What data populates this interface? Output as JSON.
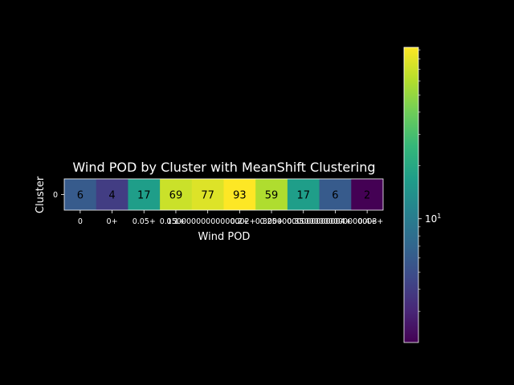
{
  "chart_data": {
    "type": "heatmap",
    "title": "Wind POD by Cluster with MeanShift Clustering",
    "xlabel": "Wind POD",
    "ylabel": "Cluster",
    "x_categories": [
      "0",
      "0+",
      "0.05+",
      "0.1+",
      "0.15+",
      "0.2+",
      "0.25+",
      "0.3+",
      "0.35+",
      "0.4+"
    ],
    "x_tick_labels_printed": [
      "0",
      "0+",
      "0.05+",
      "0.1+",
      "0.15000000000000002+",
      "0.2+",
      "0.25+",
      "0.30000000000000004+",
      "0.35000000000000003+",
      "0.4+"
    ],
    "y_categories": [
      "0"
    ],
    "values": [
      [
        6,
        4,
        17,
        69,
        77,
        93,
        59,
        17,
        6,
        2
      ]
    ],
    "colormap": "viridis",
    "colorbar": {
      "scale": "log",
      "range": [
        2,
        93
      ],
      "tick_labels": [
        "10^1"
      ],
      "major_ticks": [
        10
      ],
      "minor_ticks": [
        3,
        4,
        5,
        6,
        7,
        8,
        9,
        20,
        30,
        40,
        50,
        60,
        70,
        80,
        90
      ]
    },
    "colors": {
      "background": "#000000",
      "foreground": "#ffffff",
      "annotation_text": "#000000"
    }
  }
}
